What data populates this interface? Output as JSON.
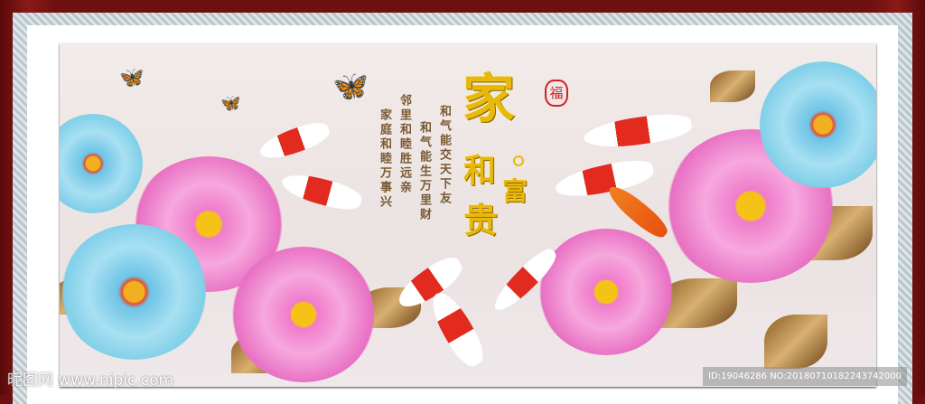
{
  "artwork": {
    "title_chars": [
      "家",
      "和",
      "富",
      "贵"
    ],
    "poem_columns": [
      "和气能交天下友",
      "和气能生万里财",
      "邻里和睦胜远亲",
      "家庭和睦万事兴"
    ],
    "seal_char": "福"
  },
  "watermark": {
    "site": "昵图网 www.nipic.com",
    "id_text": "ID:19046286 NO:20180710182243742000"
  },
  "colors": {
    "frame": "#6e1010",
    "gold": "#e8b80a",
    "pink": "#f07ccb",
    "blue": "#7fcfe8"
  }
}
